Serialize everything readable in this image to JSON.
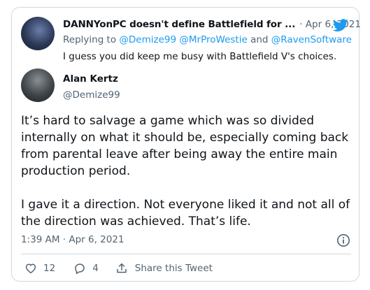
{
  "reply_tweet": {
    "display_name": "DANNYonPC doesn't define Battlefield for ...",
    "date": "· Apr 6, 2021",
    "replying_to_label": "Replying to",
    "mentions": [
      "@Demize99",
      "@MrProWestie",
      "@RavenSoftware"
    ],
    "mention_joiner": "and",
    "text": "I guess you did keep me busy with Battlefield V's choices."
  },
  "main_tweet": {
    "display_name": "Alan Kertz",
    "handle": "@Demize99",
    "paragraphs": [
      "It’s hard to salvage a game which was so divided internally on what it should be, especially coming back from parental leave after being away the entire main production period.",
      "I gave it a direction. Not everyone liked it and not all of the direction was achieved. That’s life."
    ],
    "timestamp": "1:39 AM · Apr 6, 2021"
  },
  "actions": {
    "like_count": "12",
    "reply_count": "4",
    "share_label": "Share this Tweet"
  },
  "icons": {
    "brand": "twitter-bird-icon",
    "info": "info-icon",
    "like": "heart-icon",
    "reply": "comment-bubble-icon",
    "share": "share-arrow-icon"
  },
  "colors": {
    "accent": "#1d9bf0",
    "text": "#0f1419",
    "secondary_text": "#536471",
    "border": "#cfd9de"
  }
}
